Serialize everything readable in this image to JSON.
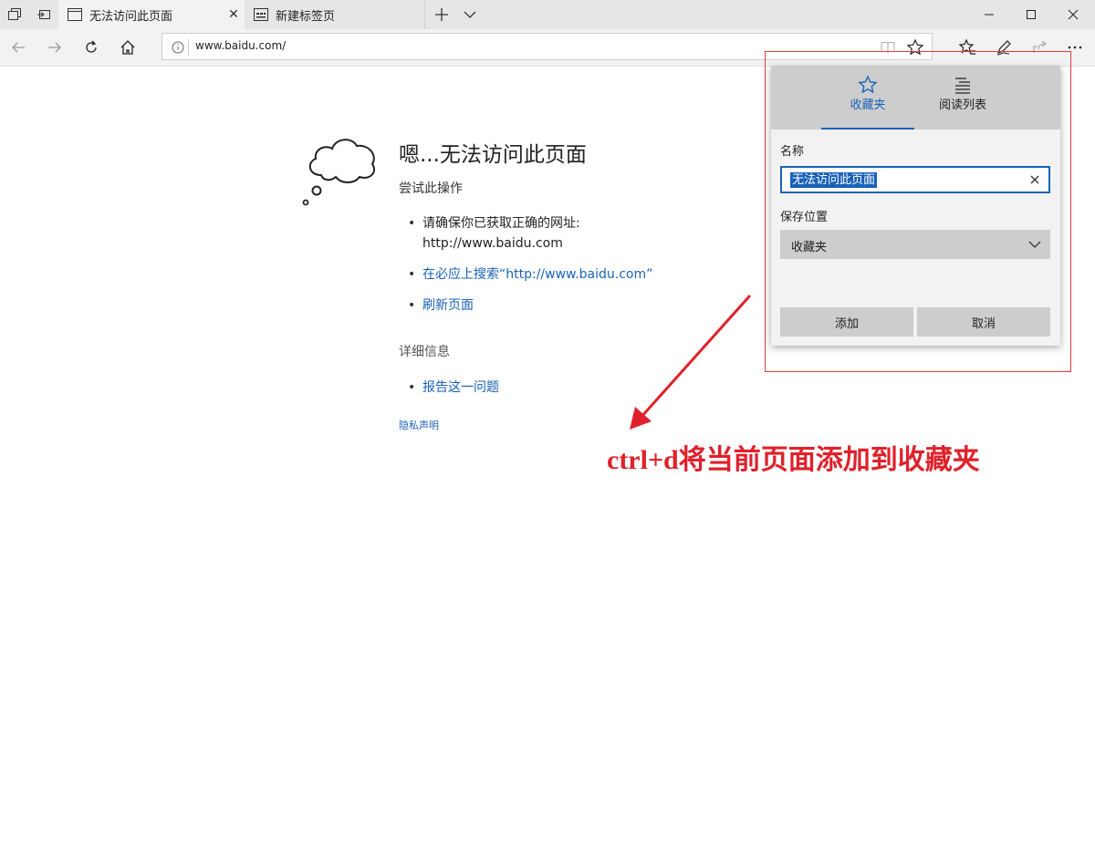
{
  "tabs": [
    {
      "title": "无法访问此页面"
    },
    {
      "title": "新建标签页"
    }
  ],
  "address": {
    "url": "www.baidu.com/"
  },
  "error_page": {
    "title": "嗯...无法访问此页面",
    "try_label": "尝试此操作",
    "suggestion_check": "请确保你已获取正确的网址:",
    "suggestion_url": "http://www.baidu.com",
    "suggestion_search": "在必应上搜索“http://www.baidu.com”",
    "suggestion_refresh": "刷新页面",
    "details_label": "详细信息",
    "report_link": "报告这一问题",
    "privacy_link": "隐私声明"
  },
  "favorite_panel": {
    "tab_favorites": "收藏夹",
    "tab_reading_list": "阅读列表",
    "name_label": "名称",
    "name_value": "无法访问此页面",
    "location_label": "保存位置",
    "location_value": "收藏夹",
    "add_button": "添加",
    "cancel_button": "取消"
  },
  "annotation": {
    "text": "ctrl+d将当前页面添加到收藏夹"
  },
  "colors": {
    "accent": "#1a62b8",
    "annotation": "#e0212b"
  }
}
